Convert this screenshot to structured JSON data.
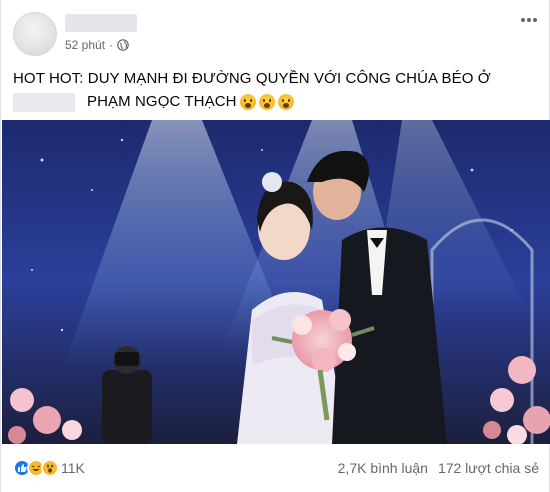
{
  "post": {
    "time": "52 phút",
    "separator": "·",
    "caption_line1": "HOT HOT: DUY MẠNH ĐI ĐƯỜNG QUYỀN VỚI CÔNG CHÚA BÉO Ở",
    "caption_line2": "PHẠM NGỌC THẠCH",
    "caption_emojis": [
      "astonished-emoji",
      "astonished-emoji",
      "astonished-emoji"
    ],
    "photo_subject": "wedding-couple"
  },
  "reactions": {
    "icons": [
      "like-reaction-icon",
      "haha-reaction-icon",
      "wow-reaction-icon"
    ],
    "count": "11K",
    "comments": "2,7K bình luận",
    "shares": "172 lượt chia sẻ"
  },
  "colors": {
    "text": "#050505",
    "muted": "#65676b",
    "like_blue": "#1877f2",
    "emoji_yellow": "#f7b928"
  }
}
